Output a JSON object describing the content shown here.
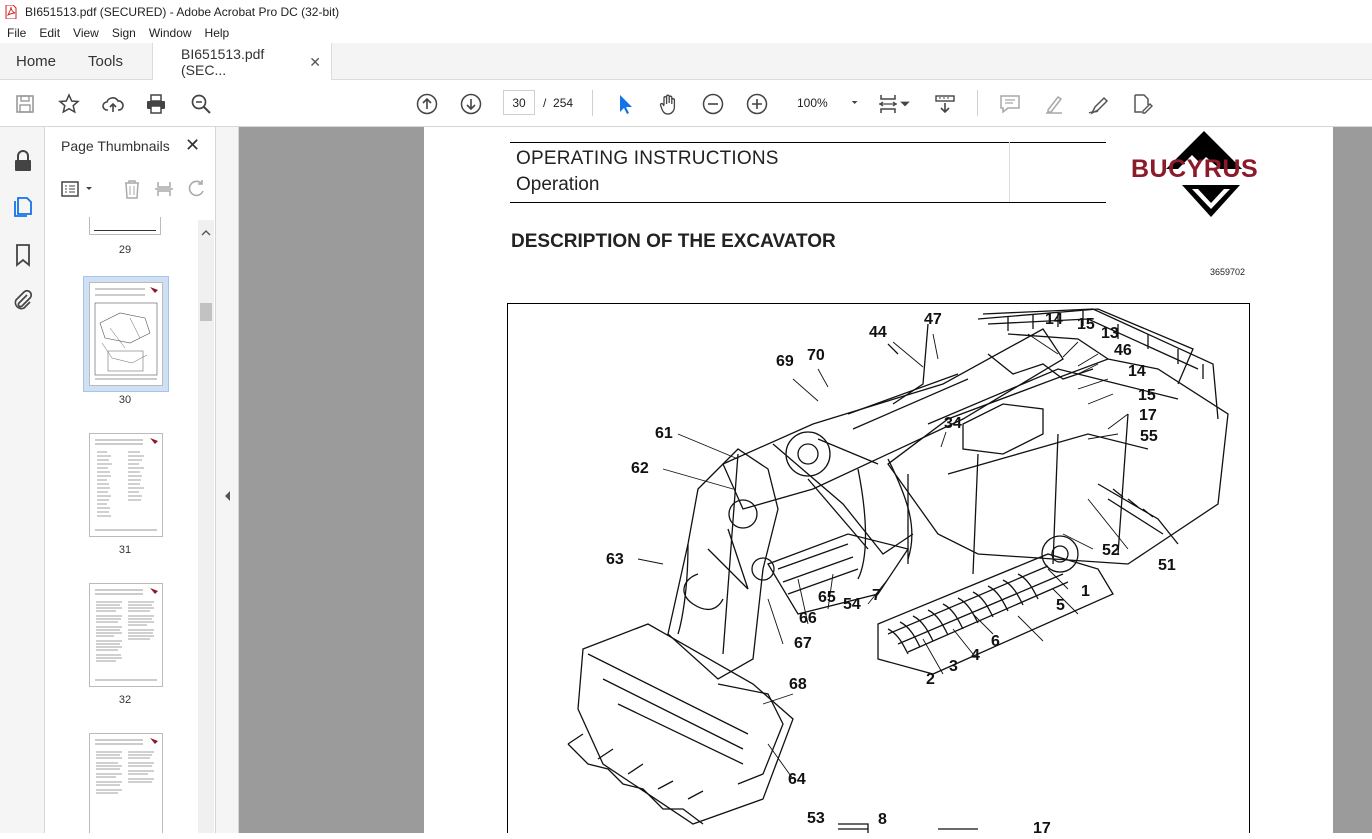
{
  "window": {
    "title": "BI651513.pdf (SECURED) - Adobe Acrobat Pro DC (32-bit)"
  },
  "menu": [
    "File",
    "Edit",
    "View",
    "Sign",
    "Window",
    "Help"
  ],
  "tabs": {
    "home": "Home",
    "tools": "Tools",
    "document": "BI651513.pdf (SEC..."
  },
  "toolbar": {
    "current_page": "30",
    "page_separator": "/",
    "total_pages": "254",
    "zoom": "100%"
  },
  "thumbnails_panel": {
    "title": "Page Thumbnails",
    "pages": [
      {
        "number": "29"
      },
      {
        "number": "30",
        "selected": true
      },
      {
        "number": "31"
      },
      {
        "number": "32"
      }
    ]
  },
  "document": {
    "header_line1": "OPERATING INSTRUCTIONS",
    "header_line2": "Operation",
    "logo": "BUCYRUS",
    "section_title": "DESCRIPTION OF THE EXCAVATOR",
    "figure_ref": "3659702",
    "callouts": [
      "47",
      "44",
      "14",
      "15",
      "13",
      "46",
      "70",
      "69",
      "14",
      "15",
      "17",
      "55",
      "34",
      "61",
      "62",
      "52",
      "51",
      "63",
      "1",
      "5",
      "66",
      "65",
      "54",
      "7",
      "6",
      "4",
      "3",
      "2",
      "67",
      "68",
      "64",
      "53",
      "8",
      "17"
    ]
  },
  "colors": {
    "brand": "#8b1a2b",
    "viewer_bg": "#9b9b9b",
    "nav_blue": "#1473e6"
  }
}
